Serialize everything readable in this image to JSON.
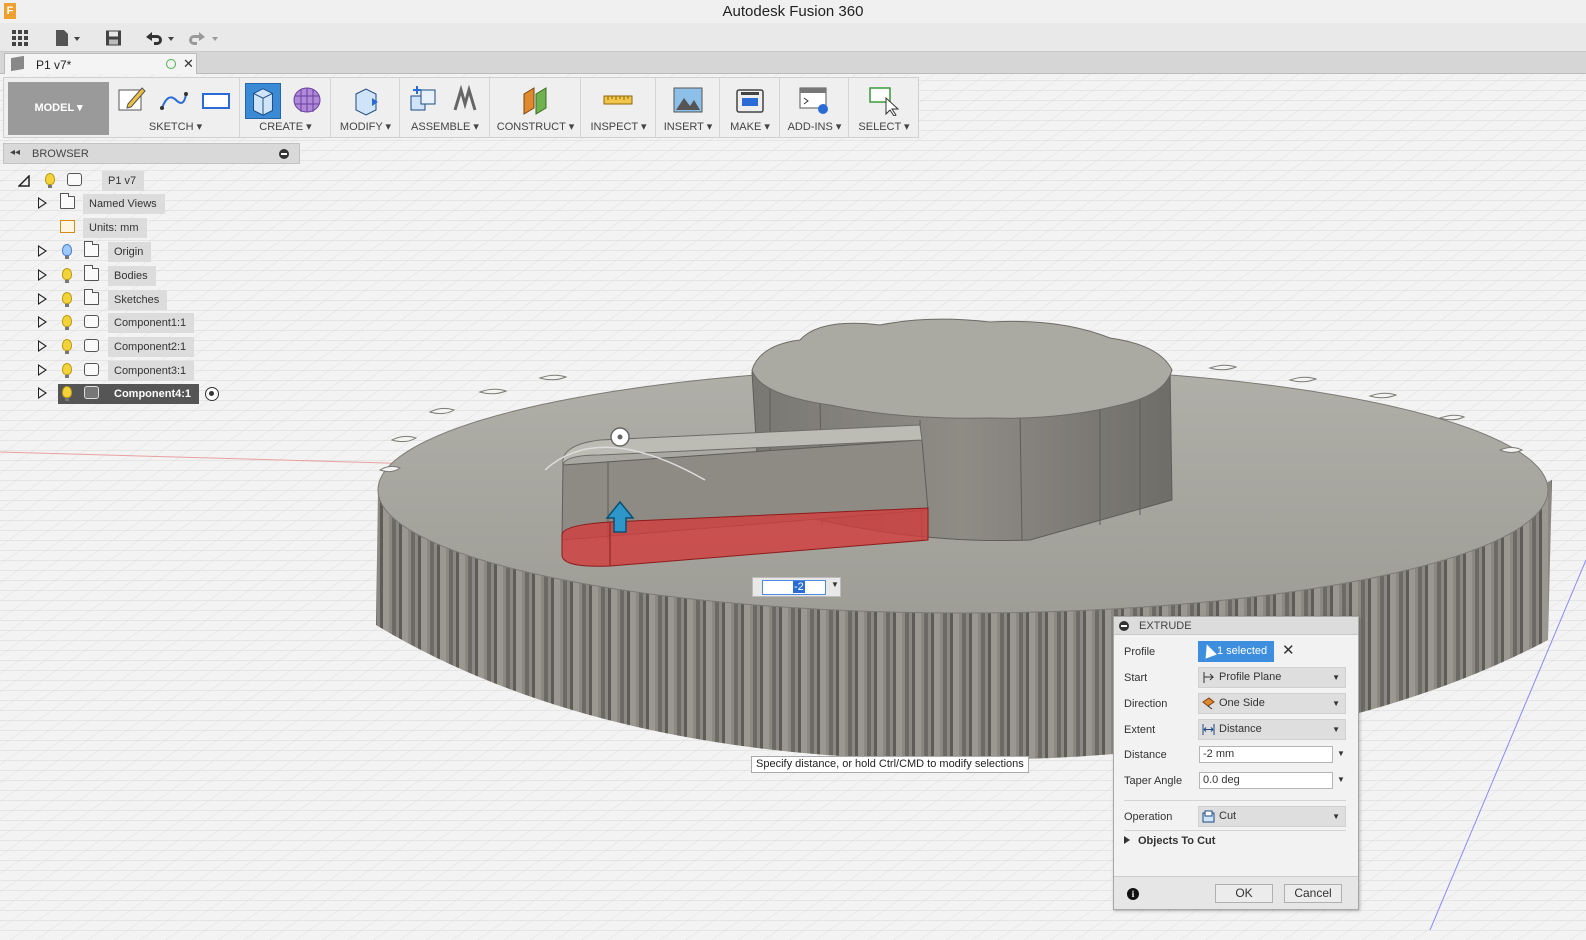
{
  "app": {
    "title": "Autodesk Fusion 360"
  },
  "document_tab": {
    "name": "P1 v7*"
  },
  "toolbar": {
    "workspace": "MODEL",
    "groups": {
      "sketch": "SKETCH",
      "create": "CREATE",
      "modify": "MODIFY",
      "assemble": "ASSEMBLE",
      "construct": "CONSTRUCT",
      "inspect": "INSPECT",
      "insert": "INSERT",
      "make": "MAKE",
      "addins": "ADD-INS",
      "select": "SELECT"
    },
    "accent_color": "#3a8ad6"
  },
  "browser": {
    "title": "BROWSER",
    "root": "P1 v7",
    "items": [
      {
        "label": "Named Views"
      },
      {
        "label": "Units: mm"
      },
      {
        "label": "Origin"
      },
      {
        "label": "Bodies"
      },
      {
        "label": "Sketches"
      },
      {
        "label": "Component1:1"
      },
      {
        "label": "Component2:1"
      },
      {
        "label": "Component3:1"
      },
      {
        "label": "Component4:1"
      }
    ]
  },
  "canvas": {
    "value_input": "-2",
    "tooltip": "Specify distance, or hold Ctrl/CMD to modify selections",
    "cut_color": "#d23c3c"
  },
  "extrude": {
    "title": "EXTRUDE",
    "profile_label": "Profile",
    "profile_value": "1 selected",
    "start_label": "Start",
    "start_value": "Profile Plane",
    "direction_label": "Direction",
    "direction_value": "One Side",
    "extent_label": "Extent",
    "extent_value": "Distance",
    "distance_label": "Distance",
    "distance_value": "-2 mm",
    "taper_label": "Taper Angle",
    "taper_value": "0.0 deg",
    "operation_label": "Operation",
    "operation_value": "Cut",
    "objects_to_cut": "Objects To Cut",
    "ok": "OK",
    "cancel": "Cancel"
  }
}
